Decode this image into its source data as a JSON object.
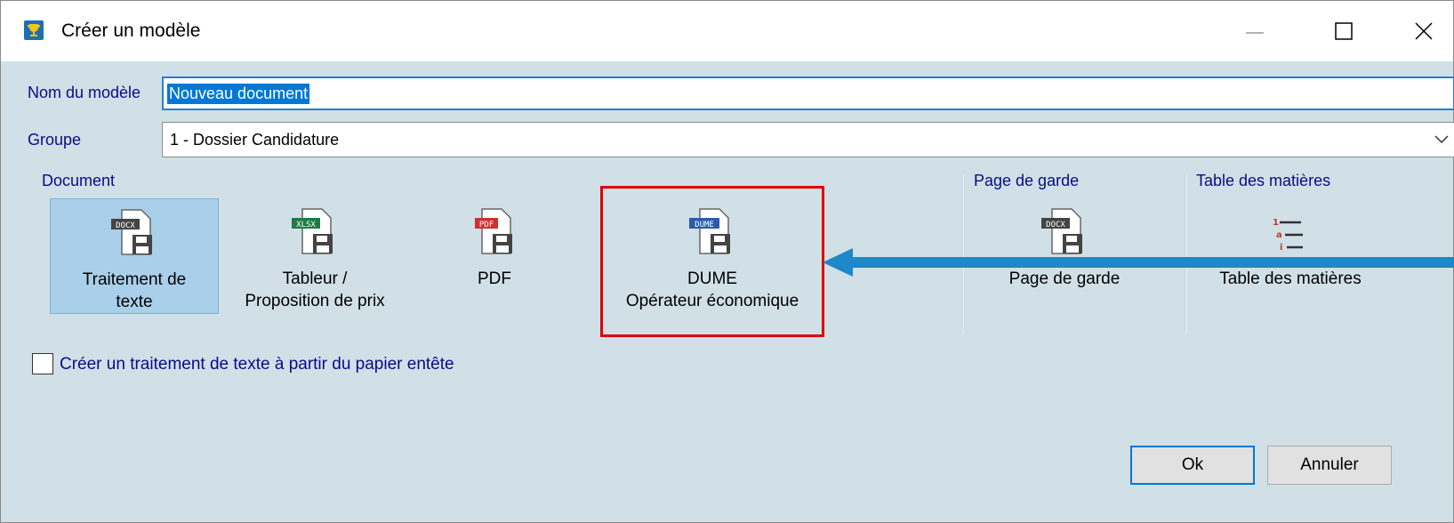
{
  "window": {
    "title": "Créer un modèle"
  },
  "form": {
    "name_label": "Nom du modèle",
    "name_value": "Nouveau document",
    "group_label": "Groupe",
    "group_value": "1 - Dossier Candidature"
  },
  "sections": {
    "document": "Document",
    "cover": "Page de garde",
    "toc": "Table des matières"
  },
  "tiles": [
    {
      "badge": "DOCX",
      "line1": "Traitement de",
      "line2": "texte",
      "selected": true
    },
    {
      "badge": "XLSX",
      "line1": "Tableur /",
      "line2": "Proposition de prix"
    },
    {
      "badge": "PDF",
      "line1": "PDF",
      "line2": ""
    },
    {
      "badge": "DUME",
      "line1": "DUME",
      "line2": "Opérateur économique"
    },
    {
      "badge": "DOCX",
      "line1": "Page de garde",
      "line2": ""
    },
    {
      "badge": "",
      "line1": "Table des matières",
      "line2": ""
    }
  ],
  "checkbox": {
    "label": "Créer un traitement de texte à partir du papier entête",
    "checked": false
  },
  "buttons": {
    "ok": "Ok",
    "cancel": "Annuler"
  },
  "colors": {
    "accent": "#0078d7",
    "highlight": "#e00000",
    "arrow": "#1e88c8",
    "background": "#d0e0e6"
  }
}
